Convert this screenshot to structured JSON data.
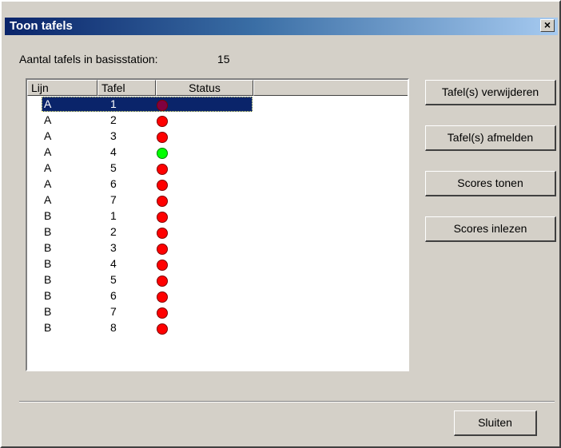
{
  "window": {
    "title": "Toon tafels",
    "close_label": "×"
  },
  "count": {
    "label": "Aantal tafels in basisstation:",
    "value": "15"
  },
  "list": {
    "columns": [
      "Lijn",
      "Tafel",
      "Status"
    ],
    "rows": [
      {
        "lijn": "A",
        "tafel": "1",
        "status": "selected",
        "color": "#800040"
      },
      {
        "lijn": "A",
        "tafel": "2",
        "status": "red",
        "color": "#ff0000"
      },
      {
        "lijn": "A",
        "tafel": "3",
        "status": "red",
        "color": "#ff0000"
      },
      {
        "lijn": "A",
        "tafel": "4",
        "status": "green",
        "color": "#00ff00"
      },
      {
        "lijn": "A",
        "tafel": "5",
        "status": "red",
        "color": "#ff0000"
      },
      {
        "lijn": "A",
        "tafel": "6",
        "status": "red",
        "color": "#ff0000"
      },
      {
        "lijn": "A",
        "tafel": "7",
        "status": "red",
        "color": "#ff0000"
      },
      {
        "lijn": "B",
        "tafel": "1",
        "status": "red",
        "color": "#ff0000"
      },
      {
        "lijn": "B",
        "tafel": "2",
        "status": "red",
        "color": "#ff0000"
      },
      {
        "lijn": "B",
        "tafel": "3",
        "status": "red",
        "color": "#ff0000"
      },
      {
        "lijn": "B",
        "tafel": "4",
        "status": "red",
        "color": "#ff0000"
      },
      {
        "lijn": "B",
        "tafel": "5",
        "status": "red",
        "color": "#ff0000"
      },
      {
        "lijn": "B",
        "tafel": "6",
        "status": "red",
        "color": "#ff0000"
      },
      {
        "lijn": "B",
        "tafel": "7",
        "status": "red",
        "color": "#ff0000"
      },
      {
        "lijn": "B",
        "tafel": "8",
        "status": "red",
        "color": "#ff0000"
      }
    ],
    "selected_index": 0
  },
  "buttons": {
    "remove": "Tafel(s) verwijderen",
    "logout": "Tafel(s) afmelden",
    "show_scores": "Scores tonen",
    "read_scores": "Scores inlezen",
    "close": "Sluiten"
  }
}
